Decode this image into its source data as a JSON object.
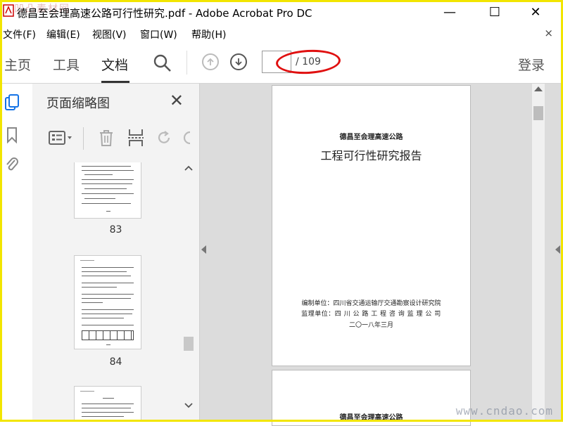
{
  "window": {
    "title": "德昌至会理高速公路可行性研究.pdf - Adobe Acrobat Pro DC",
    "minimize": "—",
    "maximize": "☐",
    "close": "✕",
    "watermark_top": "凹凸素材网"
  },
  "menu": {
    "items": [
      "文件(F)",
      "编辑(E)",
      "视图(V)",
      "窗口(W)",
      "帮助(H)"
    ],
    "close_doc": "×"
  },
  "toolbar": {
    "tabs": [
      "主页",
      "工具",
      "文档"
    ],
    "active_tab": "文档",
    "page_current": "",
    "page_total": "/ 109",
    "login": "登录"
  },
  "panel": {
    "title": "页面缩略图",
    "close": "✕",
    "thumbs": [
      {
        "label": "83"
      },
      {
        "label": "84"
      },
      {
        "label": ""
      }
    ]
  },
  "document": {
    "page1": {
      "subtitle": "德昌至会理高速公路",
      "title": "工程可行性研究报告",
      "editor": "编制单位：四川省交通运输厅交通勘察设计研究院",
      "supervisor": "监理单位：四 川 公 路 工 程 咨 询 监 理 公 司",
      "date": "二〇一八年三月"
    },
    "page2": {
      "subtitle": "德昌至会理高速公路"
    }
  },
  "watermark_site": "www.cndao.com",
  "colors": {
    "frame": "#f2e500",
    "annotation": "#e01010",
    "panel_bg": "#f3f3f3",
    "doc_bg": "#dcdcdc"
  }
}
